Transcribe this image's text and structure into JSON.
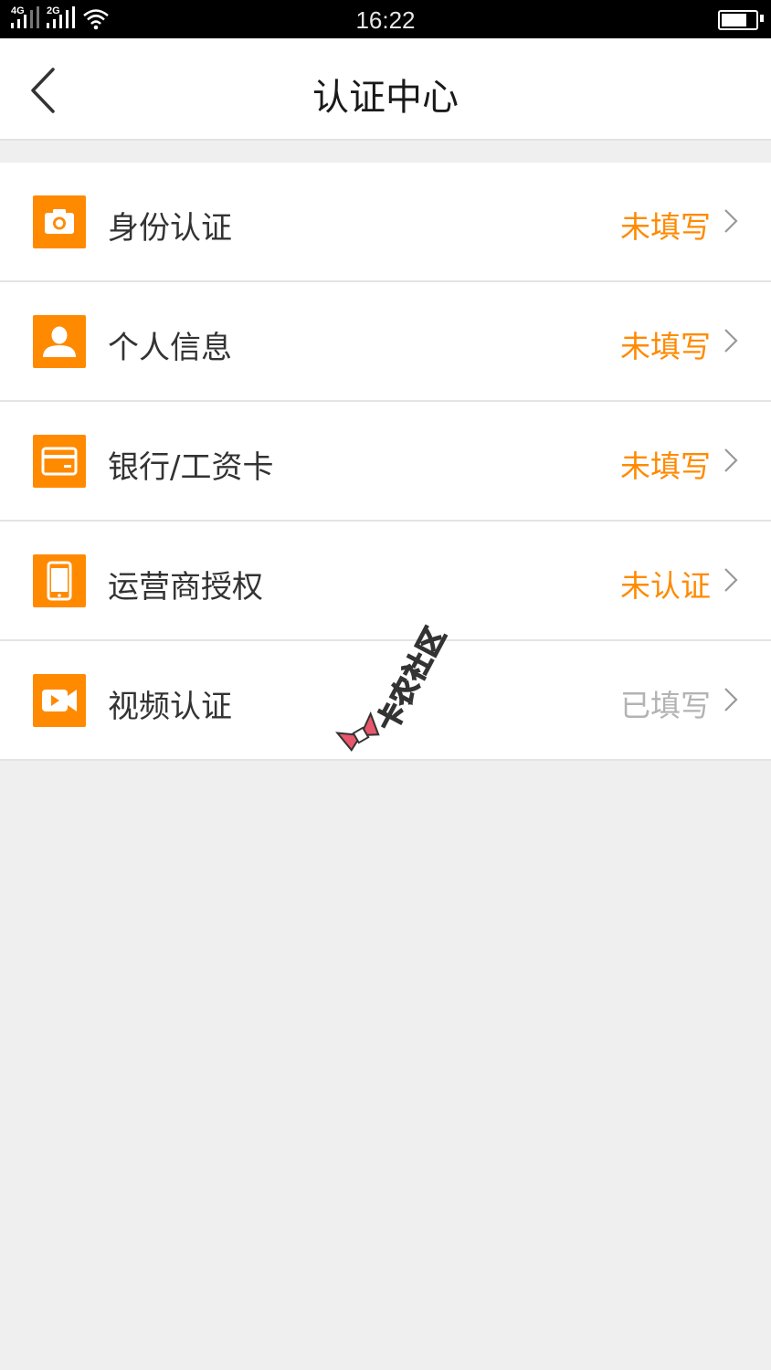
{
  "status_bar": {
    "time": "16:22",
    "sim1_label": "4G",
    "sim2_label": "2G",
    "battery_level": 0.75
  },
  "header": {
    "title": "认证中心"
  },
  "rows": [
    {
      "label": "身份认证",
      "status": "未填写",
      "status_color": "#ff8a00",
      "icon": "camera-icon"
    },
    {
      "label": "个人信息",
      "status": "未填写",
      "status_color": "#ff8a00",
      "icon": "person-icon"
    },
    {
      "label": "银行/工资卡",
      "status": "未填写",
      "status_color": "#ff8a00",
      "icon": "card-icon"
    },
    {
      "label": "运营商授权",
      "status": "未认证",
      "status_color": "#ff8a00",
      "icon": "phone-icon"
    },
    {
      "label": "视频认证",
      "status": "已填写",
      "status_color": "#b3b3b3",
      "icon": "video-icon"
    }
  ],
  "watermark": {
    "text": "卡农社区"
  },
  "colors": {
    "accent": "#ff8a00",
    "muted": "#b3b3b3",
    "background": "#efefef"
  }
}
